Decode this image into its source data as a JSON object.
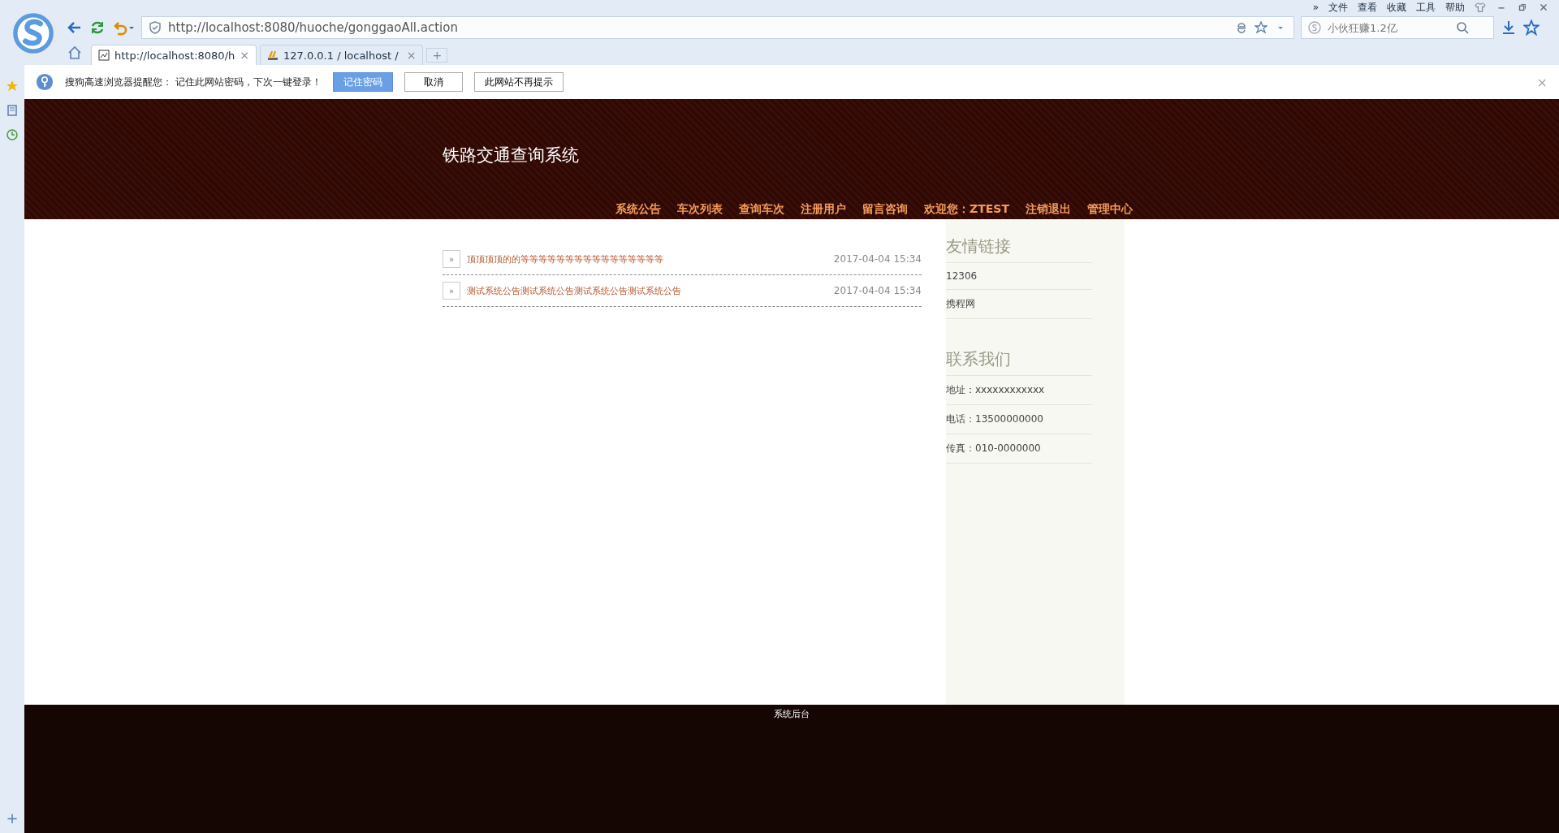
{
  "browser": {
    "menu": [
      "»",
      "文件",
      "查看",
      "收藏",
      "工具",
      "帮助"
    ],
    "address": "http://localhost:8080/huoche/gonggaoAll.action",
    "search": {
      "placeholder": "小伙狂赚1.2亿"
    },
    "tabs": [
      {
        "label": "http://localhost:8080/h",
        "selected": true,
        "close": "×"
      },
      {
        "label": "127.0.0.1 / localhost / ",
        "selected": false,
        "close": "×"
      }
    ],
    "new_tab": "+"
  },
  "infobar": {
    "message": "搜狗高速浏览器提醒您： 记住此网站密码，下次一键登录！",
    "buttons": [
      {
        "label": "记住密码",
        "primary": true
      },
      {
        "label": "取消",
        "primary": false
      },
      {
        "label": "此网站不再提示",
        "primary": false
      }
    ],
    "close": "×"
  },
  "side_panel": {
    "add": "+"
  },
  "site": {
    "title": "铁路交通查询系统",
    "nav": [
      "系统公告",
      "车次列表",
      "查询车次",
      "注册用户",
      "留言咨询",
      "欢迎您：ZTEST",
      "注销退出",
      "管理中心"
    ],
    "notices": [
      {
        "bullet": "»",
        "title": "顶顶顶顶的的等等等等等等等等等等等等等等等等",
        "date": "2017-04-04 15:34"
      },
      {
        "bullet": "»",
        "title": "测试系统公告测试系统公告测试系统公告测试系统公告",
        "date": "2017-04-04 15:34"
      }
    ],
    "sidebar": [
      {
        "heading": "友情链接",
        "items": [
          "12306",
          "携程网"
        ]
      },
      {
        "heading": "联系我们",
        "items": [
          "地址：xxxxxxxxxxxx",
          "电话：13500000000",
          "传真：010-0000000"
        ]
      }
    ],
    "footer": "系统后台"
  }
}
